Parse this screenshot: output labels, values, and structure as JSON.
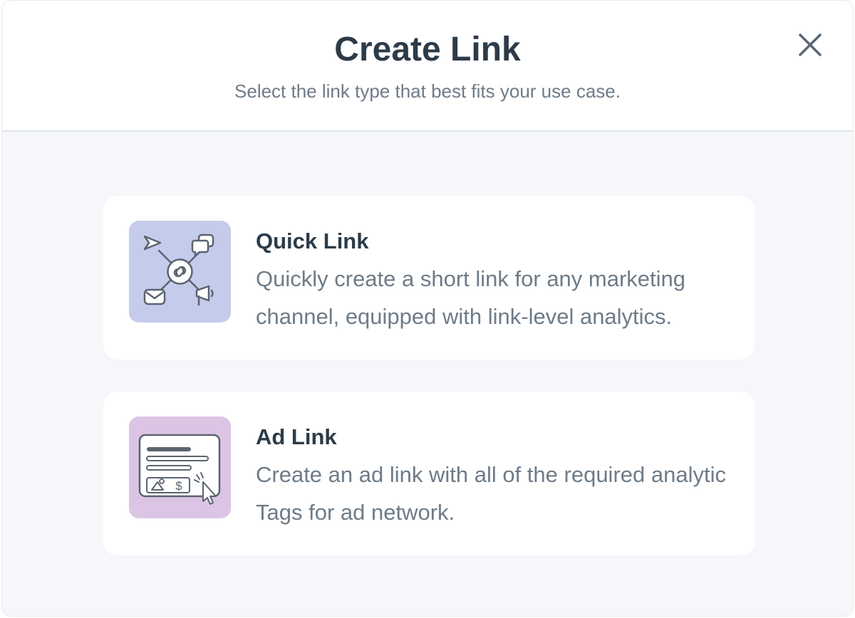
{
  "dialog": {
    "title": "Create Link",
    "subtitle": "Select the link type that best fits your use case.",
    "close_icon": "close-icon"
  },
  "options": [
    {
      "title": "Quick Link",
      "description": "Quickly create a short link for any marketing channel, equipped with link-level analytics.",
      "icon": "quick-link-network-icon",
      "icon_bg": "#c5cbeb"
    },
    {
      "title": "Ad Link",
      "description": "Create an ad link with all of the required analytic Tags for ad network.",
      "icon": "ad-link-banner-icon",
      "icon_bg": "#dcc4e4"
    }
  ],
  "colors": {
    "heading": "#2d3b48",
    "muted": "#6e7b88",
    "background": "#f5f7fa"
  }
}
